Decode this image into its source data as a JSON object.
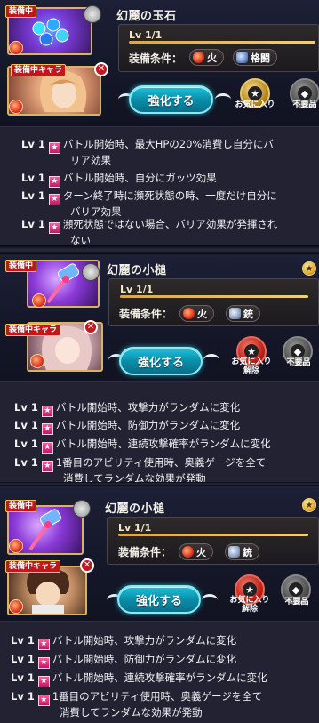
{
  "common": {
    "equipped_tag": "装備中",
    "equipped_char_tag": "装備中キャラ",
    "enhance_label": "強化する",
    "equip_req_label": "装備条件：",
    "unneeded_label": "不要品",
    "lv_prefix": "Lv 1",
    "element_fire": "火"
  },
  "panels": [
    {
      "name": "幻麗の玉石",
      "level": "Lv 1/1",
      "weapon_type": "格闘",
      "favorite_label": "お気に入り",
      "skills": [
        {
          "lv": "Lv 1",
          "text": "バトル開始時、最大HPの20%消費し自分にバ",
          "cont": "リア効果"
        },
        {
          "lv": "Lv 1",
          "text": "バトル開始時、自分にガッツ効果",
          "cont": ""
        },
        {
          "lv": "Lv 1",
          "text": "ターン終了時に瀕死状態の時、一度だけ自分に",
          "cont": "バリア効果"
        },
        {
          "lv": "Lv 1",
          "text": "瀕死状態ではない場合、バリア効果が発揮され",
          "cont": "ない"
        }
      ]
    },
    {
      "name": "幻麗の小槌",
      "level": "Lv 1/1",
      "weapon_type": "銃",
      "favorite_label_1": "お気に入り",
      "favorite_label_2": "解除",
      "skills": [
        {
          "lv": "Lv 1",
          "text": "バトル開始時、攻撃力がランダムに変化",
          "cont": ""
        },
        {
          "lv": "Lv 1",
          "text": "バトル開始時、防御力がランダムに変化",
          "cont": ""
        },
        {
          "lv": "Lv 1",
          "text": "バトル開始時、連続攻撃確率がランダムに変化",
          "cont": ""
        },
        {
          "lv": "Lv 1",
          "text": "1番目のアビリティ使用時、奥義ゲージを全て",
          "cont": "消費してランダムな効果が発動"
        }
      ]
    },
    {
      "name": "幻麗の小槌",
      "level": "Lv 1/1",
      "weapon_type": "銃",
      "favorite_label_1": "お気に入り",
      "favorite_label_2": "解除",
      "skills": [
        {
          "lv": "Lv 1",
          "text": "バトル開始時、攻撃力がランダムに変化",
          "cont": ""
        },
        {
          "lv": "Lv 1",
          "text": "バトル開始時、防御力がランダムに変化",
          "cont": ""
        },
        {
          "lv": "Lv 1",
          "text": "バトル開始時、連続攻撃確率がランダムに変化",
          "cont": ""
        },
        {
          "lv": "Lv 1",
          "text": "1番目のアビリティ使用時、奥義ゲージを全て",
          "cont": "消費してランダムな効果が発動"
        }
      ]
    }
  ]
}
